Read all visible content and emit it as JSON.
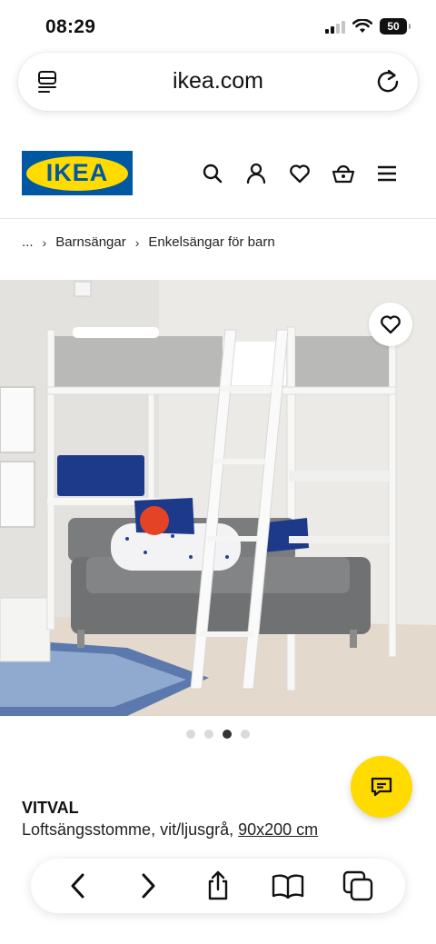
{
  "status_bar": {
    "time": "08:29",
    "battery": "50"
  },
  "browser": {
    "url": "ikea.com"
  },
  "header": {
    "logo_text": "IKEA"
  },
  "breadcrumb": {
    "ellipsis": "...",
    "items": [
      "Barnsängar",
      "Enkelsängar för barn"
    ]
  },
  "carousel": {
    "total": 4,
    "active_index": 2
  },
  "product": {
    "name": "VITVAL",
    "description": "Loftsängsstomme, vit/ljusgrå,",
    "size": "90x200 cm"
  },
  "colors": {
    "ikea_blue": "#0058a3",
    "ikea_yellow": "#ffdb00"
  },
  "icons": {
    "url_left": "reader-icon",
    "url_right": "reload-icon",
    "header": [
      "search-icon",
      "user-icon",
      "heart-icon",
      "basket-icon",
      "menu-icon"
    ],
    "toolbar": [
      "back-icon",
      "forward-icon",
      "share-icon",
      "bookmarks-icon",
      "tabs-icon"
    ]
  }
}
